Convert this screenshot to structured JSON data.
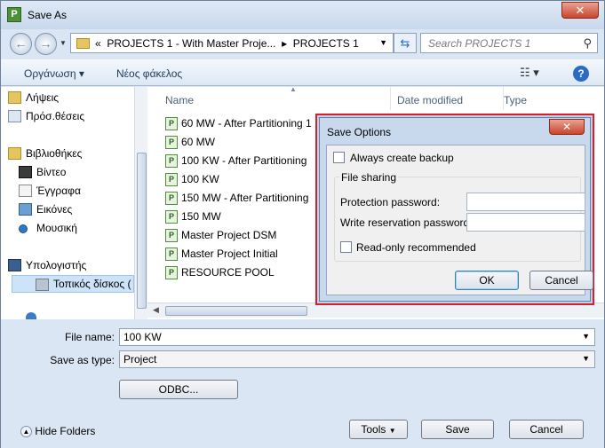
{
  "window": {
    "title": "Save As",
    "close_glyph": "✕"
  },
  "address": {
    "crumb_prefix": "«",
    "path_1": "PROJECTS 1 - With Master Proje...",
    "separator": "▸",
    "path_2": "PROJECTS 1",
    "search_placeholder": "Search PROJECTS 1"
  },
  "toolbar": {
    "organize": "Οργάνωση ▾",
    "new_folder": "Νέος φάκελος",
    "view_glyph": "☷ ▾",
    "help_glyph": "?"
  },
  "nav": {
    "items": [
      {
        "label": "Λήψεις",
        "icon": "downloads-folder-icon"
      },
      {
        "label": "Πρόσ.θέσεις",
        "icon": "recent-places-icon"
      },
      {
        "label": "Βιβλιοθήκες",
        "icon": "libraries-icon"
      },
      {
        "label": "Βίντεο",
        "icon": "video-library-icon"
      },
      {
        "label": "Έγγραφα",
        "icon": "documents-library-icon"
      },
      {
        "label": "Εικόνες",
        "icon": "pictures-library-icon"
      },
      {
        "label": "Μουσική",
        "icon": "music-library-icon"
      },
      {
        "label": "Υπολογιστής",
        "icon": "computer-icon"
      },
      {
        "label": "Τοπικός δίσκος (",
        "icon": "local-disk-icon"
      }
    ]
  },
  "columns": {
    "name": "Name",
    "date_modified": "Date modified",
    "type": "Type"
  },
  "files": [
    "60 MW - After Partitioning 1",
    "60 MW",
    "100 KW - After Partitioning",
    "100 KW",
    "150 MW - After Partitioning",
    "150 MW",
    "Master Project DSM",
    "Master Project Initial",
    "RESOURCE POOL"
  ],
  "form": {
    "file_name_label": "File name:",
    "file_name_value": "100 KW",
    "save_type_label": "Save as type:",
    "save_type_value": "Project",
    "odbc_button": "ODBC...",
    "hide_folders": "Hide Folders",
    "tools_button": "Tools",
    "save_button": "Save",
    "cancel_button": "Cancel"
  },
  "save_options": {
    "title": "Save Options",
    "always_backup_label": "Always create backup",
    "file_sharing_label": "File sharing",
    "protection_password_label": "Protection password:",
    "write_reservation_label": "Write reservation password:",
    "read_only_label": "Read-only recommended",
    "ok_button": "OK",
    "cancel_button": "Cancel",
    "highlight_color": "#d4202a"
  }
}
